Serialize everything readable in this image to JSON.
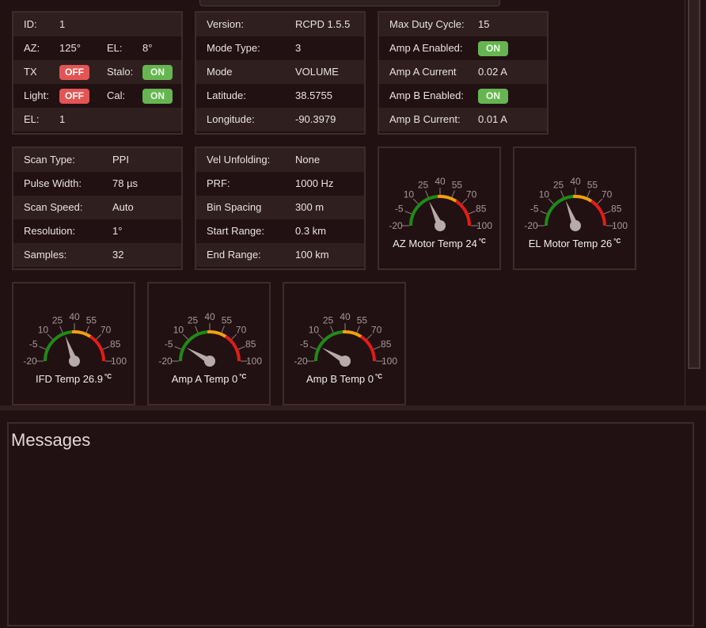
{
  "status_panel": {
    "id_label": "ID:",
    "id_value": "1",
    "az_label": "AZ:",
    "az_value": "125°",
    "el_label": "EL:",
    "el_value": "8°",
    "tx_label": "TX",
    "tx_state": "OFF",
    "stalo_label": "Stalo:",
    "stalo_state": "ON",
    "light_label": "Light:",
    "light_state": "OFF",
    "cal_label": "Cal:",
    "cal_state": "ON",
    "el2_label": "EL:",
    "el2_value": "1"
  },
  "info_panel": {
    "rows": [
      {
        "label": "Version:",
        "value": "RCPD 1.5.5"
      },
      {
        "label": "Mode Type:",
        "value": "3"
      },
      {
        "label": "Mode",
        "value": "VOLUME"
      },
      {
        "label": "Latitude:",
        "value": "38.5755"
      },
      {
        "label": "Longitude:",
        "value": "-90.3979"
      }
    ]
  },
  "amp_panel": {
    "max_duty_label": "Max Duty Cycle:",
    "max_duty_value": "15",
    "amp_a_enabled_label": "Amp A Enabled:",
    "amp_a_enabled_state": "ON",
    "amp_a_current_label": "Amp A Current",
    "amp_a_current_value": "0.02 A",
    "amp_b_enabled_label": "Amp B Enabled:",
    "amp_b_enabled_state": "ON",
    "amp_b_current_label": "Amp B Current:",
    "amp_b_current_value": "0.01 A"
  },
  "scan_panel": {
    "rows": [
      {
        "label": "Scan Type:",
        "value": "PPI"
      },
      {
        "label": "Pulse Width:",
        "value": "78 µs"
      },
      {
        "label": "Scan Speed:",
        "value": "Auto"
      },
      {
        "label": "Resolution:",
        "value": "1°"
      },
      {
        "label": "Samples:",
        "value": "32"
      }
    ]
  },
  "range_panel": {
    "rows": [
      {
        "label": "Vel Unfolding:",
        "value": "None"
      },
      {
        "label": "PRF:",
        "value": "1000 Hz"
      },
      {
        "label": "Bin Spacing",
        "value": "300 m"
      },
      {
        "label": "Start Range:",
        "value": "0.3 km"
      },
      {
        "label": "End Range:",
        "value": "100 km"
      }
    ]
  },
  "gauge_scale": {
    "ticks": [
      "-20",
      "-5",
      "10",
      "25",
      "40",
      "55",
      "70",
      "85",
      "100"
    ],
    "min": -20,
    "max": 100,
    "zones": [
      {
        "from": -20,
        "to": 37,
        "color": "#1f8a18"
      },
      {
        "from": 37,
        "to": 62,
        "color": "#f2a10f"
      },
      {
        "from": 62,
        "to": 100,
        "color": "#e11d16"
      }
    ],
    "needle_color": "#b7aaaa",
    "unit": "°C"
  },
  "gauges": [
    {
      "title": "AZ Motor Temp 24",
      "value": 24
    },
    {
      "title": "EL Motor Temp 26",
      "value": 26
    },
    {
      "title": "IFD Temp 26.9",
      "value": 26.9
    },
    {
      "title": "Amp A Temp 0",
      "value": 0
    },
    {
      "title": "Amp B Temp 0",
      "value": 0
    }
  ],
  "messages": {
    "title": "Messages"
  }
}
